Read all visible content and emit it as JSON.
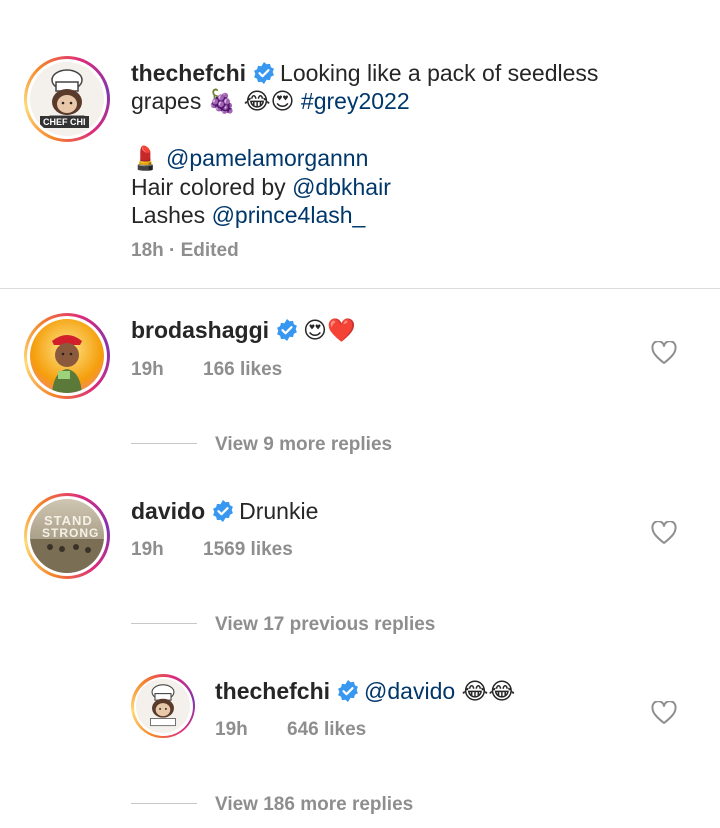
{
  "caption": {
    "username": "thechefchi",
    "text_line1": "Looking like a pack of seedless",
    "text_line2": "grapes",
    "emojis_line2": "🍇 😂😍",
    "hashtag": "#grey2022",
    "lipstick_emoji": "💄",
    "mention1": "@pamelamorgannn",
    "hair_prefix": "Hair colored by",
    "mention2": "@dbkhair",
    "lashes_prefix": "Lashes",
    "mention3": "@prince4lash_",
    "meta": "18h · Edited"
  },
  "comments": [
    {
      "username": "brodashaggi",
      "text": "😍❤️",
      "time": "19h",
      "likes": "166 likes",
      "view_replies": "View 9 more replies"
    },
    {
      "username": "davido",
      "text": "Drunkie",
      "time": "19h",
      "likes": "1569 likes",
      "view_replies": "View 17 previous replies"
    }
  ],
  "reply": {
    "username": "thechefchi",
    "mention": "@davido",
    "emojis": "😂😂",
    "time": "19h",
    "likes": "646 likes",
    "view_replies": "View 186 more replies"
  },
  "avatars": {
    "chef_badge": "CHEF CHI",
    "davido_line1": "STAND",
    "davido_line2": "STRONG"
  },
  "colors": {
    "mention": "#00376b",
    "verified": "#3897f0",
    "meta": "#8e8e8e"
  }
}
